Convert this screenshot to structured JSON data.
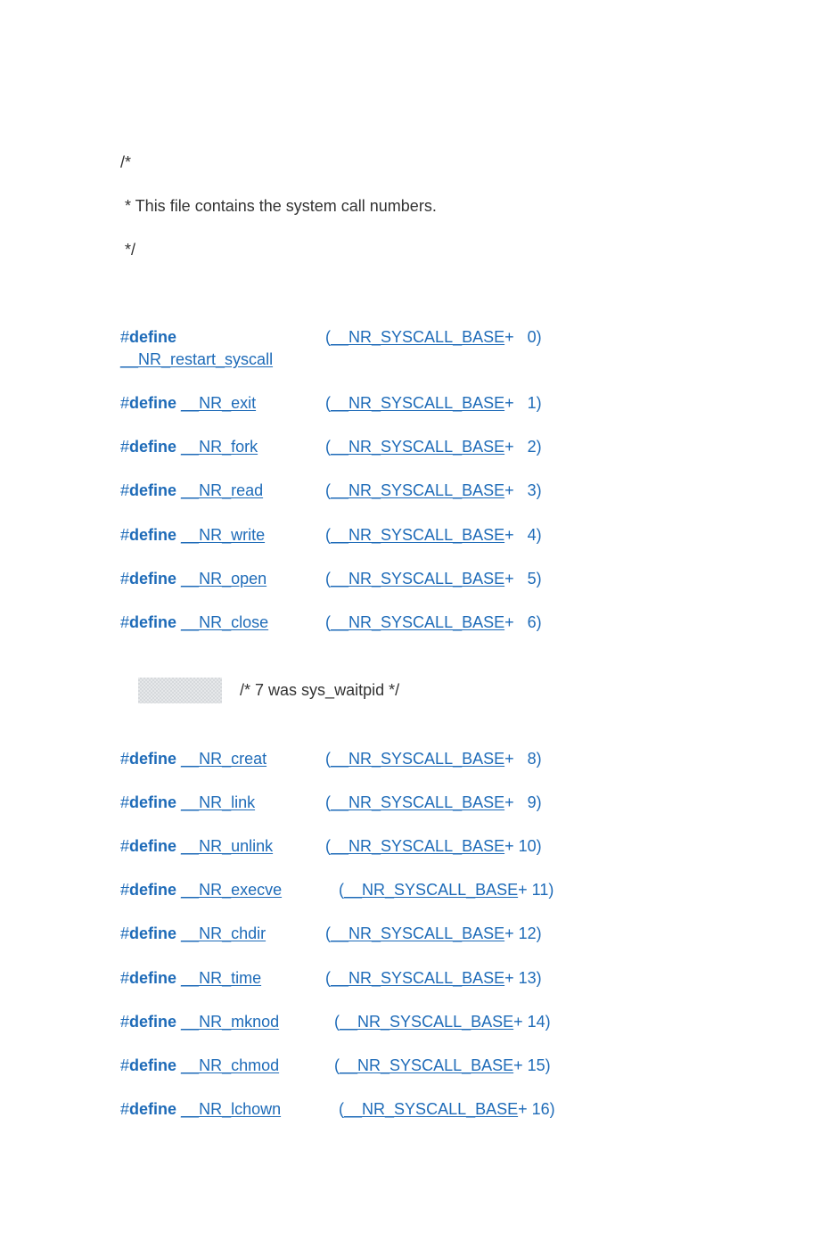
{
  "comment_open": "/*",
  "comment_body": " * This file contains the system call numbers.",
  "comment_close": " */",
  "base_token": "__NR_SYSCALL_BASE",
  "define_kw": "define",
  "removed_comment": "/* 7 was sys_waitpid */",
  "defs": [
    {
      "name": "__NR_restart_syscall",
      "num": "0",
      "pad_num": "   0",
      "name_pad": "__NR_restart_syscall     ",
      "indent": ""
    },
    {
      "name": "__NR_exit",
      "num": "1",
      "pad_num": "   1",
      "name_pad": "__NR_exit            ",
      "indent": ""
    },
    {
      "name": "__NR_fork",
      "num": "2",
      "pad_num": "   2",
      "name_pad": "__NR_fork            ",
      "indent": ""
    },
    {
      "name": "__NR_read",
      "num": "3",
      "pad_num": "   3",
      "name_pad": "__NR_read            ",
      "indent": ""
    },
    {
      "name": "__NR_write",
      "num": "4",
      "pad_num": "   4",
      "name_pad": "__NR_write           ",
      "indent": ""
    },
    {
      "name": "__NR_open",
      "num": "5",
      "pad_num": "   5",
      "name_pad": "__NR_open           ",
      "indent": ""
    },
    {
      "name": "__NR_close",
      "num": "6",
      "pad_num": "   6",
      "name_pad": "__NR_close           ",
      "indent": ""
    }
  ],
  "defs2": [
    {
      "name": "__NR_creat",
      "num": "8",
      "pad_num": "   8",
      "name_pad": "__NR_creat            ",
      "indent": ""
    },
    {
      "name": "__NR_link",
      "num": "9",
      "pad_num": "   9",
      "name_pad": "__NR_link             ",
      "indent": ""
    },
    {
      "name": "__NR_unlink",
      "num": "10",
      "pad_num": " 10",
      "name_pad": "__NR_unlink          ",
      "indent": ""
    },
    {
      "name": "__NR_execve",
      "num": "11",
      "pad_num": " 11",
      "name_pad": "__NR_execve             ",
      "indent": "   "
    },
    {
      "name": "__NR_chdir",
      "num": "12",
      "pad_num": " 12",
      "name_pad": "__NR_chdir           ",
      "indent": ""
    },
    {
      "name": "__NR_time",
      "num": "13",
      "pad_num": " 13",
      "name_pad": "__NR_time           ",
      "indent": ""
    },
    {
      "name": "__NR_mknod",
      "num": "14",
      "pad_num": " 14",
      "name_pad": "__NR_mknod             ",
      "indent": "  "
    },
    {
      "name": "__NR_chmod",
      "num": "15",
      "pad_num": " 15",
      "name_pad": "__NR_chmod             ",
      "indent": "  "
    },
    {
      "name": "__NR_lchown",
      "num": "16",
      "pad_num": " 16",
      "name_pad": "__NR_lchown             ",
      "indent": "   "
    }
  ]
}
